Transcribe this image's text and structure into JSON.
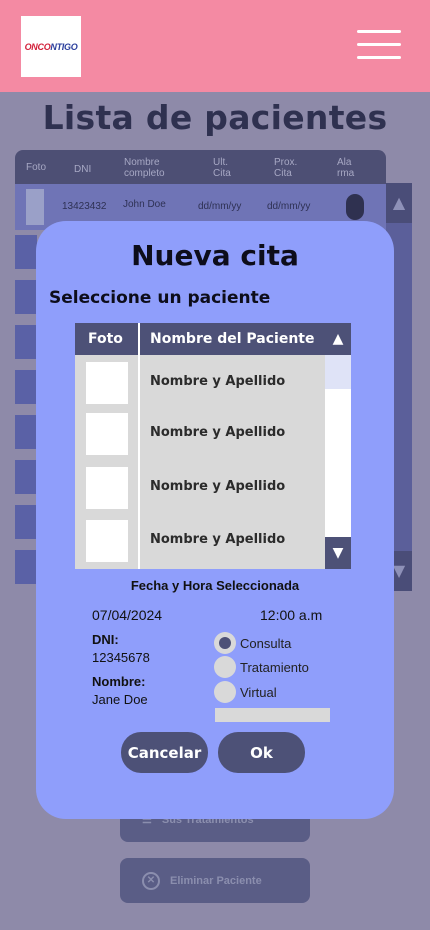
{
  "header": {
    "logo_text_a": "ONCO",
    "logo_text_b": "NTIGO"
  },
  "page": {
    "title": "Lista de pacientes"
  },
  "table": {
    "headers": [
      "Foto",
      "DNI",
      "Nombre completo",
      "Ult. Cita",
      "Prox. Cita",
      "Ala rma"
    ],
    "header_lines": {
      "nombre": [
        "Nombre",
        "completo"
      ],
      "ult": [
        "Ult.",
        "Cita"
      ],
      "prox": [
        "Prox.",
        "Cita"
      ],
      "alarma": [
        "Ala",
        "rma"
      ]
    },
    "row": {
      "dni": "13423432",
      "name": "John Doe",
      "ult": "dd/mm/yy",
      "prox": "dd/mm/yy"
    }
  },
  "background_buttons": {
    "tratamientos": "Sus Tratamientos",
    "eliminar": "Eliminar Paciente"
  },
  "modal": {
    "title": "Nueva cita",
    "subtitle": "Seleccione un paciente",
    "table_headers": {
      "foto": "Foto",
      "nombre": "Nombre del Paciente"
    },
    "patients": [
      "Nombre y Apellido",
      "Nombre y Apellido",
      "Nombre y Apellido",
      "Nombre y Apellido"
    ],
    "fecha_hora_label": "Fecha y Hora Seleccionada",
    "date": "07/04/2024",
    "time": "12:00 a.m",
    "dni_label": "DNI:",
    "dni_value": "12345678",
    "nombre_label": "Nombre:",
    "nombre_value": "Jane Doe",
    "options": [
      "Consulta",
      "Tratamiento",
      "Virtual"
    ],
    "selected_option": "Consulta",
    "cancel": "Cancelar",
    "ok": "Ok"
  },
  "colors": {
    "header": "#f48aa3",
    "modal": "#8f9efb",
    "primary": "#4d5177"
  }
}
